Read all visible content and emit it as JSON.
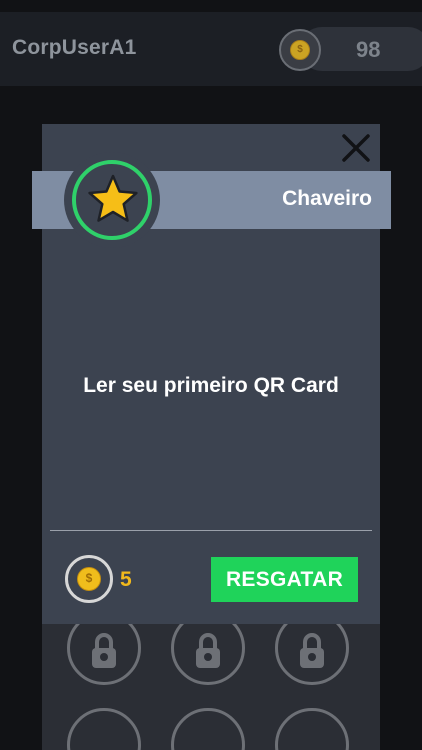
{
  "header": {
    "username": "CorpUserA1",
    "coin_balance": "98",
    "coin_glyph": "$"
  },
  "modal": {
    "title": "Chaveiro",
    "badge_icon": "star-icon",
    "description": "Ler seu primeiro QR Card",
    "reward_value": "5",
    "reward_coin_glyph": "$",
    "redeem_label": "RESGATAR",
    "close_icon": "close-icon"
  },
  "background_grid": {
    "items": [
      {
        "icon": "lock-icon",
        "state": "locked"
      },
      {
        "icon": "lock-icon",
        "state": "locked"
      },
      {
        "icon": "lock-icon",
        "state": "locked"
      },
      {
        "icon": "lock-icon",
        "state": "locked"
      },
      {
        "icon": "lock-icon",
        "state": "locked"
      },
      {
        "icon": "lock-icon",
        "state": "locked"
      }
    ]
  },
  "colors": {
    "accent_green": "#2fd16a",
    "button_green": "#1fd35a",
    "coin_gold": "#f0bd1c",
    "reward_text": "#f2b91c",
    "star_gold": "#f6be17",
    "modal_bg": "#3c4350",
    "header_band": "#7f8da3"
  }
}
